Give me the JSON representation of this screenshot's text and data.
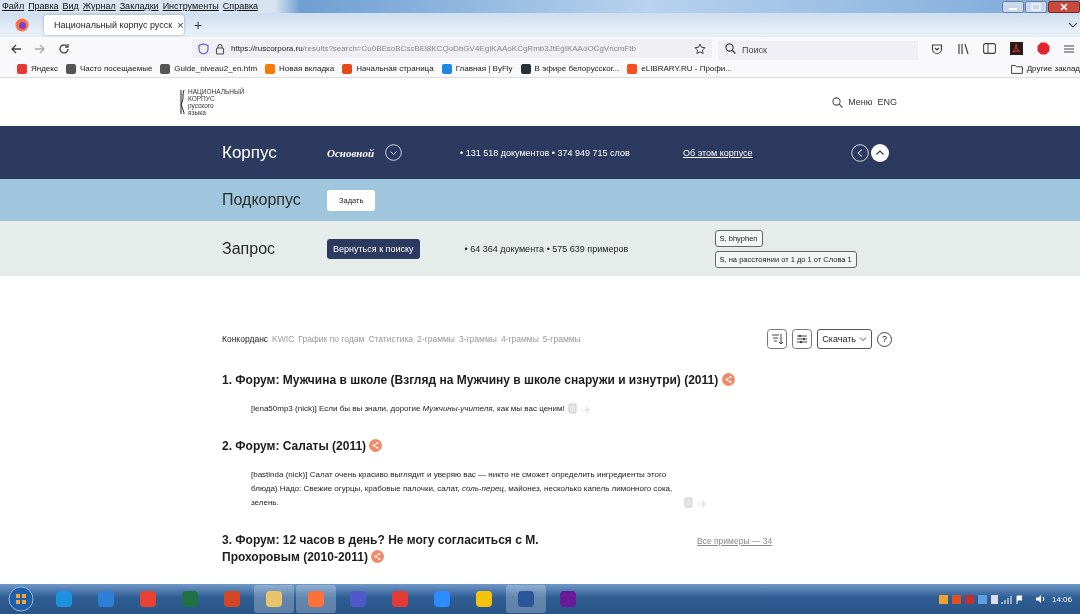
{
  "browser": {
    "menu": [
      "Файл",
      "Правка",
      "Вид",
      "Журнал",
      "Закладки",
      "Инструменты",
      "Справка"
    ],
    "tab": {
      "title": "Национальный корпус русск",
      "close": "×",
      "selected": true
    },
    "new_tab": "+",
    "url": {
      "host": "https://ruscorpora.ru",
      "path": "/results?search=Cu0BEsoBCscBEl8KCQoDbGV4EgIKAAoKCgRmb3JtEgIKAAoOCgVncmFtb"
    },
    "search": {
      "placeholder": "Поиск"
    },
    "bookmarks": [
      {
        "label": "Яндекс",
        "color": "#e53935"
      },
      {
        "label": "Часто посещаемые",
        "color": "#555555"
      },
      {
        "label": "Guide_niveau2_en.htm",
        "color": "#555555"
      },
      {
        "label": "Новая вкладка",
        "color": "#f57c00"
      },
      {
        "label": "Начальная страница",
        "color": "#e64a19"
      },
      {
        "label": "Главная | ByFly",
        "color": "#1e88e5"
      },
      {
        "label": "В эфире белорусског...",
        "color": "#263238"
      },
      {
        "label": "eLIBRARY.RU - Профи...",
        "color": "#f4511e"
      }
    ],
    "other_bookmarks": "Другие заклад"
  },
  "site": {
    "logo": [
      "НАЦИОНАЛЬНЫЙ",
      "КОРПУС",
      "русского",
      "языка"
    ],
    "menu": "Меню",
    "lang": "ENG"
  },
  "corpus": {
    "label": "Корпус",
    "name": "Основной",
    "stats": "• 131 518 документов • 374 949 715 слов",
    "link": "Об этом корпусе"
  },
  "subcorpus": {
    "label": "Подкорпус",
    "button": "Задать"
  },
  "query": {
    "label": "Запрос",
    "button": "Вернуться к поиску",
    "stats": "• 64 364 документа • 575 639 примеров",
    "tags": [
      "S, bhyphen",
      "S, на расстоянии от 1 до 1 от Слова 1"
    ]
  },
  "view_tabs": [
    {
      "label": "Конкорданс",
      "selected": true
    },
    {
      "label": "KWIC",
      "selected": false
    },
    {
      "label": "График по годам",
      "selected": false
    },
    {
      "label": "Статистика",
      "selected": false
    },
    {
      "label": "2-граммы",
      "selected": false
    },
    {
      "label": "3-граммы",
      "selected": false
    },
    {
      "label": "4-граммы",
      "selected": false
    },
    {
      "label": "5-граммы",
      "selected": false
    }
  ],
  "download": "Скачать",
  "help": "?",
  "results": [
    {
      "title": "1. Форум: Мужчина в школе (Взгляд на Мужчину в школе снаружи и изнутри) (2011)",
      "snippets": [
        "[lena50mp3 (nick)] Если бы вы знали, дорогие *Мужчины*-*учителя*, как мы вас ценим!"
      ]
    },
    {
      "title": "2. Форум: Салаты (2011)",
      "snippets": [
        "[bastinda (nick)] Салат очень красиво выглядит и уверяю вас — никто не сможет определить ингредиенты этого блюда) Надо: Свежие огурцы, крабовые палочки, салат, *соль*-*перец*, майонез, несколько капель лимонного сока, зелень."
      ]
    },
    {
      "title": "3. Форум: 12 часов в день? Не могу согласиться с М. Прохоровым (2010-2011)",
      "all_examples": "Все примеры — 34"
    }
  ],
  "taskbar": {
    "clock": "14:06"
  }
}
